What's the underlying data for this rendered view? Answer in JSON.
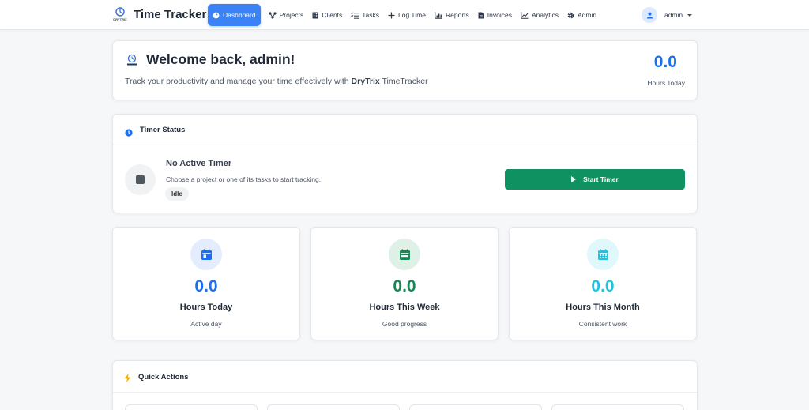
{
  "brand": {
    "title": "Time Tracker",
    "logo_text": "DRYTRIX"
  },
  "nav": [
    {
      "label": "Dashboard",
      "icon": "dashboard-icon",
      "active": true
    },
    {
      "label": "Projects",
      "icon": "projects-icon"
    },
    {
      "label": "Clients",
      "icon": "clients-icon"
    },
    {
      "label": "Tasks",
      "icon": "tasks-icon"
    },
    {
      "label": "Log Time",
      "icon": "plus-icon"
    },
    {
      "label": "Reports",
      "icon": "reports-icon"
    },
    {
      "label": "Invoices",
      "icon": "invoices-icon"
    },
    {
      "label": "Analytics",
      "icon": "analytics-icon"
    },
    {
      "label": "Admin",
      "icon": "gear-icon"
    }
  ],
  "user": {
    "name": "admin"
  },
  "welcome": {
    "heading": "Welcome back, admin!",
    "subtitle_prefix": "Track your productivity and manage your time effectively with ",
    "subtitle_brand": "DryTrix",
    "subtitle_suffix": " TimeTracker",
    "hours_today_value": "0.0",
    "hours_today_label": "Hours Today"
  },
  "timer": {
    "title": "Timer Status",
    "status_heading": "No Active Timer",
    "status_text": "Choose a project or one of its tasks to start tracking.",
    "badge": "Idle",
    "start_label": "Start Timer"
  },
  "stats": [
    {
      "value": "0.0",
      "label": "Hours Today",
      "note": "Active day",
      "color": "#1d6ff2",
      "bg": "#e3edfd",
      "icon": "calendar-day-icon"
    },
    {
      "value": "0.0",
      "label": "Hours This Week",
      "note": "Good progress",
      "color": "#198754",
      "bg": "#dff1e7",
      "icon": "calendar-week-icon"
    },
    {
      "value": "0.0",
      "label": "Hours This Month",
      "note": "Consistent work",
      "color": "#1ec4e4",
      "bg": "#e0f7fb",
      "icon": "calendar-month-icon"
    }
  ],
  "quick_actions": {
    "title": "Quick Actions"
  },
  "colors": {
    "primary": "#3b82f6",
    "success": "#0f9161"
  }
}
